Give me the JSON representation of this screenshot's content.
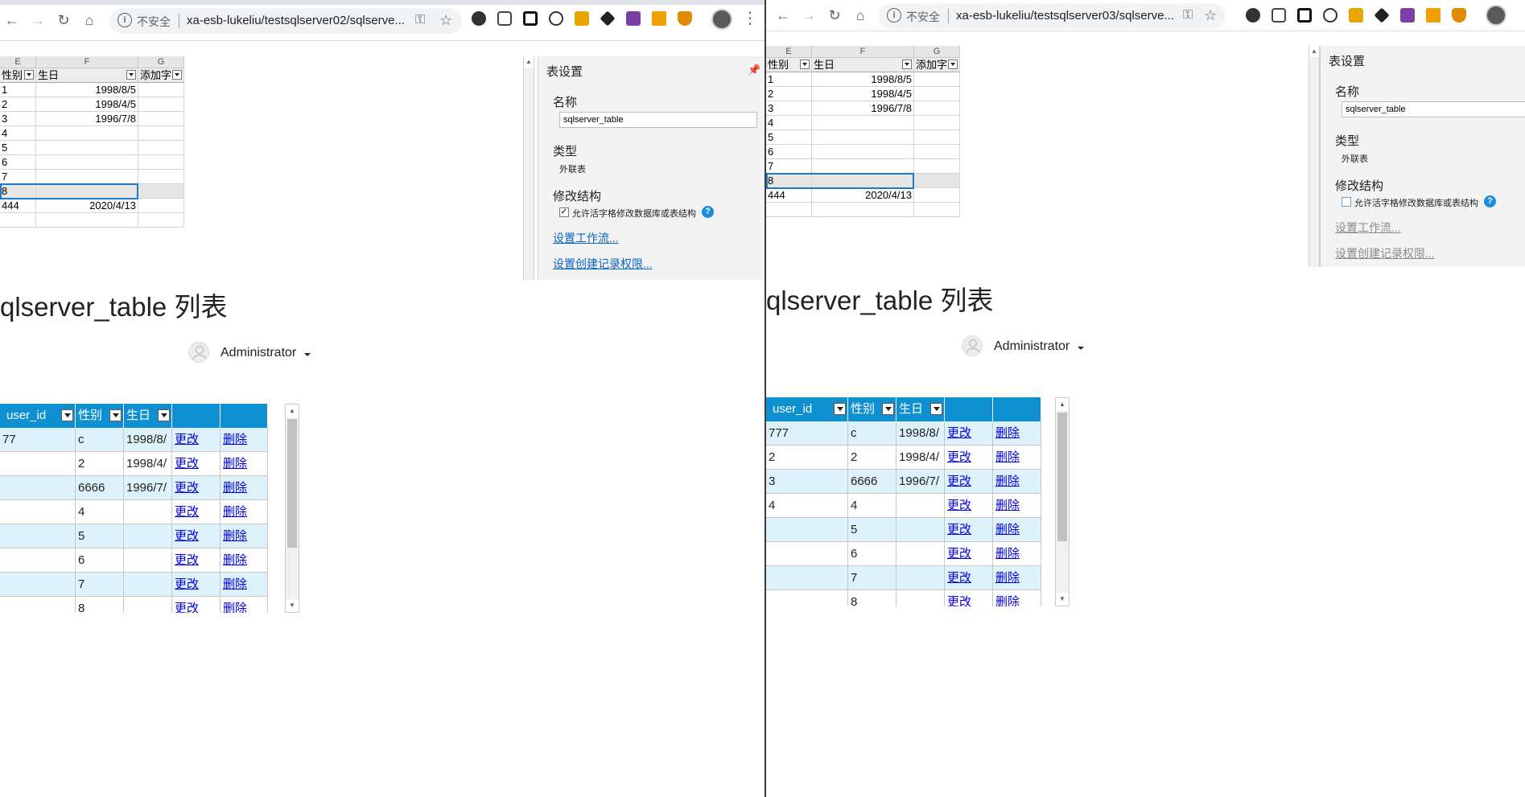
{
  "colors": {
    "list_header_bg": "#0f90d0",
    "list_alt_row_bg": "#ddf2fb",
    "link": "#0000ee",
    "help_icon": "#1a8de0",
    "selection_border": "#217ac6"
  },
  "left": {
    "browser": {
      "security_label": "不安全",
      "url": "xa-esb-lukeliu/testsqlserver02/sqlserve..."
    },
    "sheet": {
      "col_headers": [
        "E",
        "F",
        "G"
      ],
      "headers": [
        "性别",
        "生日",
        "添加字"
      ],
      "rows": [
        [
          "1",
          "1998/8/5",
          ""
        ],
        [
          "2",
          "1998/4/5",
          ""
        ],
        [
          "3",
          "1996/7/8",
          ""
        ],
        [
          "4",
          "",
          ""
        ],
        [
          "5",
          "",
          ""
        ],
        [
          "6",
          "",
          ""
        ],
        [
          "7",
          "",
          ""
        ],
        [
          "8",
          "",
          ""
        ],
        [
          "444",
          "2020/4/13",
          ""
        ],
        [
          "",
          "",
          ""
        ]
      ]
    },
    "settings": {
      "title": "表设置",
      "name_label": "名称",
      "name_value": "sqlserver_table",
      "type_label": "类型",
      "type_value": "外联表",
      "modify_label": "修改结构",
      "allow_label": "允许活字格修改数据库或表结构",
      "allow_checked": true,
      "workflow_link": "设置工作流...",
      "permission_link": "设置创建记录权限..."
    },
    "page": {
      "title": "qlserver_table 列表",
      "user": "Administrator",
      "table": {
        "headers": [
          "user_id",
          "性别",
          "生日",
          "",
          ""
        ],
        "rows": [
          [
            "77",
            "c",
            "1998/8/",
            "更改",
            "删除"
          ],
          [
            "",
            "2",
            "1998/4/",
            "更改",
            "删除"
          ],
          [
            "",
            "6666",
            "1996/7/",
            "更改",
            "删除"
          ],
          [
            "",
            "4",
            "",
            "更改",
            "删除"
          ],
          [
            "",
            "5",
            "",
            "更改",
            "删除"
          ],
          [
            "",
            "6",
            "",
            "更改",
            "删除"
          ],
          [
            "",
            "7",
            "",
            "更改",
            "删除"
          ],
          [
            "",
            "8",
            "",
            "更改",
            "删除"
          ]
        ]
      }
    }
  },
  "right": {
    "browser": {
      "security_label": "不安全",
      "url": "xa-esb-lukeliu/testsqlserver03/sqlserve..."
    },
    "sheet": {
      "col_headers": [
        "E",
        "F",
        "G"
      ],
      "headers": [
        "性别",
        "生日",
        "添加字"
      ],
      "rows": [
        [
          "1",
          "1998/8/5",
          ""
        ],
        [
          "2",
          "1998/4/5",
          ""
        ],
        [
          "3",
          "1996/7/8",
          ""
        ],
        [
          "4",
          "",
          ""
        ],
        [
          "5",
          "",
          ""
        ],
        [
          "6",
          "",
          ""
        ],
        [
          "7",
          "",
          ""
        ],
        [
          "8",
          "",
          ""
        ],
        [
          "444",
          "2020/4/13",
          ""
        ],
        [
          "",
          "",
          ""
        ]
      ]
    },
    "settings": {
      "title": "表设置",
      "name_label": "名称",
      "name_value": "sqlserver_table",
      "type_label": "类型",
      "type_value": "外联表",
      "modify_label": "修改结构",
      "allow_label": "允许活字格修改数据库或表结构",
      "allow_checked": false,
      "workflow_link": "设置工作流...",
      "permission_link": "设置创建记录权限..."
    },
    "page": {
      "title": "qlserver_table 列表",
      "user": "Administrator",
      "table": {
        "headers": [
          "user_id",
          "性别",
          "生日",
          "",
          ""
        ],
        "rows": [
          [
            "777",
            "c",
            "1998/8/",
            "更改",
            "删除"
          ],
          [
            "2",
            "2",
            "1998/4/",
            "更改",
            "删除"
          ],
          [
            "3",
            "6666",
            "1996/7/",
            "更改",
            "删除"
          ],
          [
            "4",
            "4",
            "",
            "更改",
            "删除"
          ],
          [
            "",
            "5",
            "",
            "更改",
            "删除"
          ],
          [
            "",
            "6",
            "",
            "更改",
            "删除"
          ],
          [
            "",
            "7",
            "",
            "更改",
            "删除"
          ],
          [
            "",
            "8",
            "",
            "更改",
            "删除"
          ]
        ]
      }
    }
  }
}
